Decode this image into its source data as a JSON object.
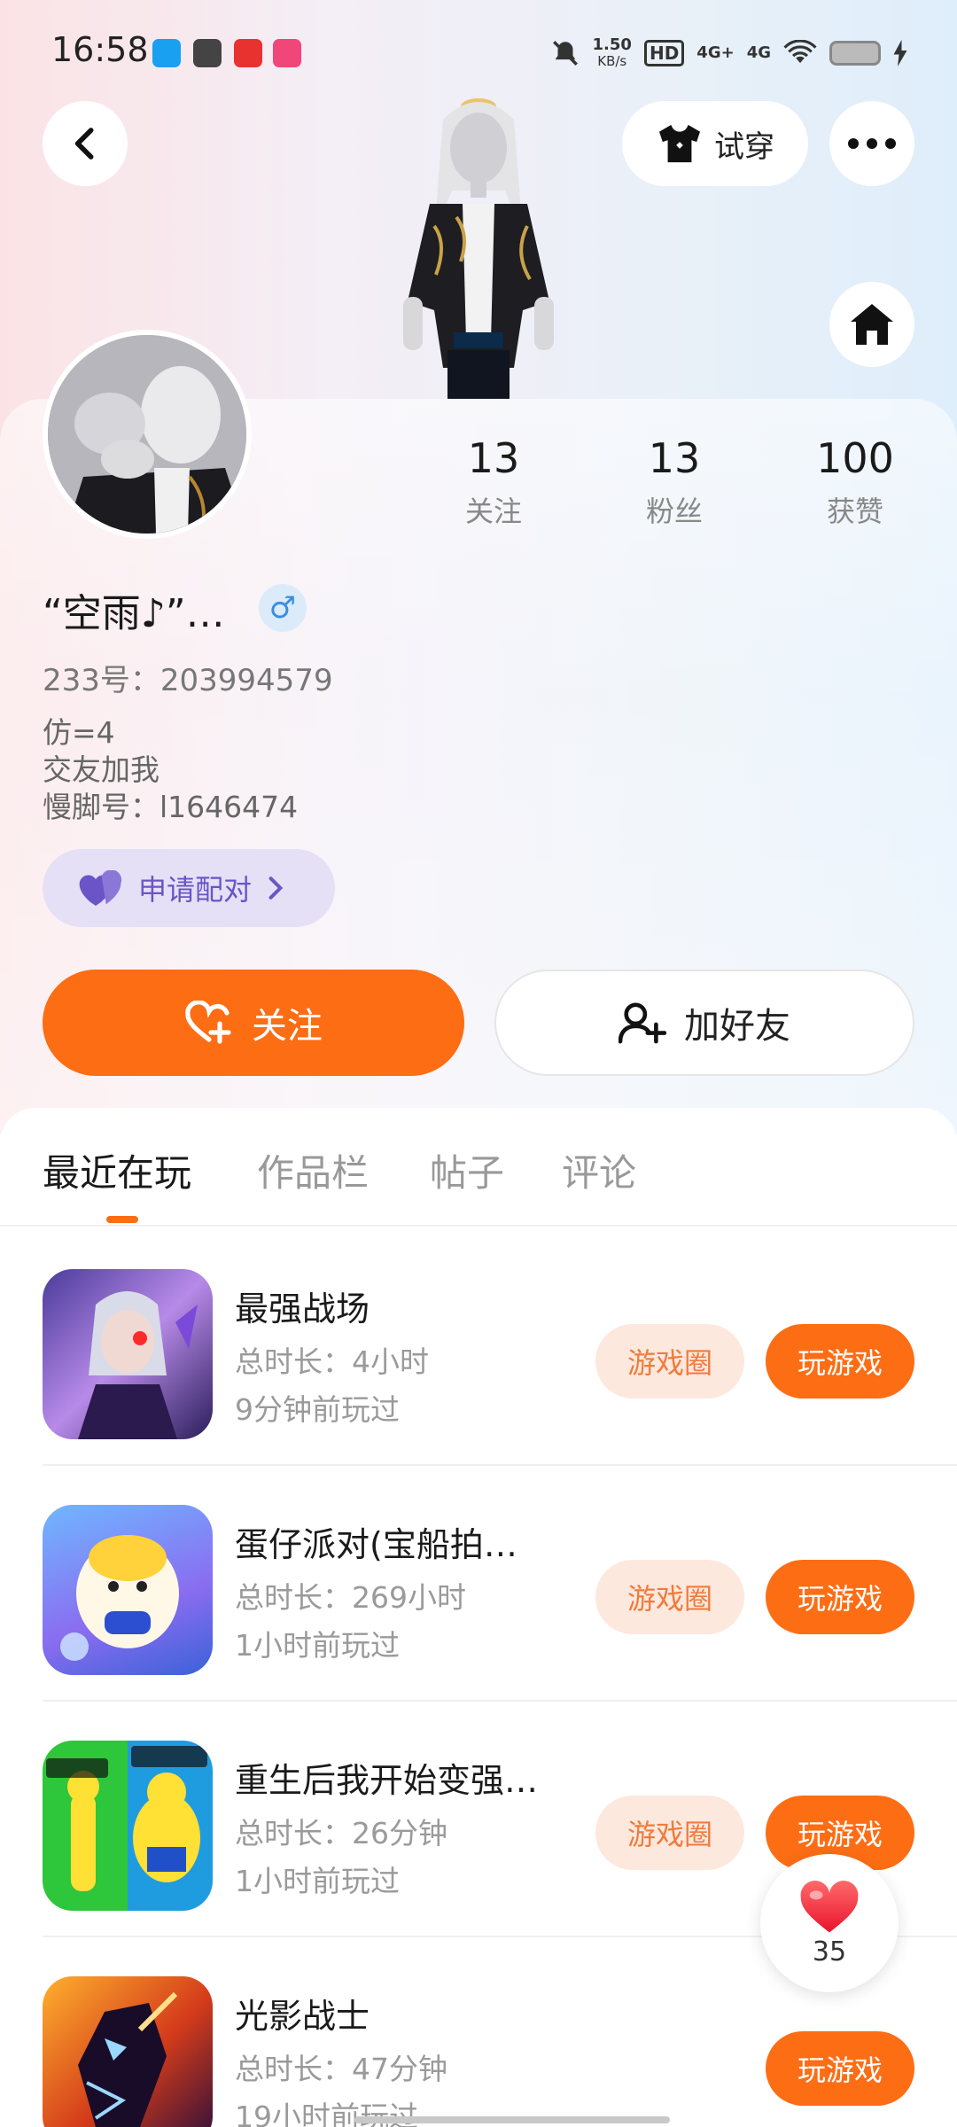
{
  "status_bar": {
    "time": "16:58",
    "net_speed_top": "1.50",
    "net_speed_bottom": "KB/s",
    "hd_label": "HD",
    "signal1": "4G+",
    "signal2": "4G"
  },
  "header": {
    "try_on_label": "试穿"
  },
  "profile": {
    "name": "“空雨♪”…",
    "gender_symbol": "♂",
    "uid": "233号：203994579",
    "bio_lines": [
      "仿=4",
      "交友加我",
      "慢脚号：l1646474"
    ],
    "stats": [
      {
        "value": "13",
        "label": "关注"
      },
      {
        "value": "13",
        "label": "粉丝"
      },
      {
        "value": "100",
        "label": "获赞"
      }
    ],
    "pair_label": "申请配对"
  },
  "actions": {
    "follow_label": "关注",
    "add_friend_label": "加好友"
  },
  "tabs": [
    {
      "label": "最近在玩",
      "active": true
    },
    {
      "label": "作品栏",
      "active": false
    },
    {
      "label": "帖子",
      "active": false
    },
    {
      "label": "评论",
      "active": false
    }
  ],
  "games": [
    {
      "title": "最强战场",
      "duration": "总时长：4小时",
      "last_played": "9分钟前玩过",
      "circle_label": "游戏圈",
      "play_label": "玩游戏"
    },
    {
      "title": "蛋仔派对(宝船拍…",
      "duration": "总时长：269小时",
      "last_played": "1小时前玩过",
      "circle_label": "游戏圈",
      "play_label": "玩游戏"
    },
    {
      "title": "重生后我开始变强…",
      "duration": "总时长：26分钟",
      "last_played": "1小时前玩过",
      "circle_label": "游戏圈",
      "play_label": "玩游戏"
    },
    {
      "title": "光影战士",
      "duration": "总时长：47分钟",
      "last_played": "19小时前玩过",
      "circle_label": "",
      "play_label": "玩游戏"
    }
  ],
  "like_fab": {
    "count": "35"
  },
  "colors": {
    "accent": "#fd6d14",
    "pair_purple": "#6a54c6",
    "circle_bg": "#fde8de"
  }
}
